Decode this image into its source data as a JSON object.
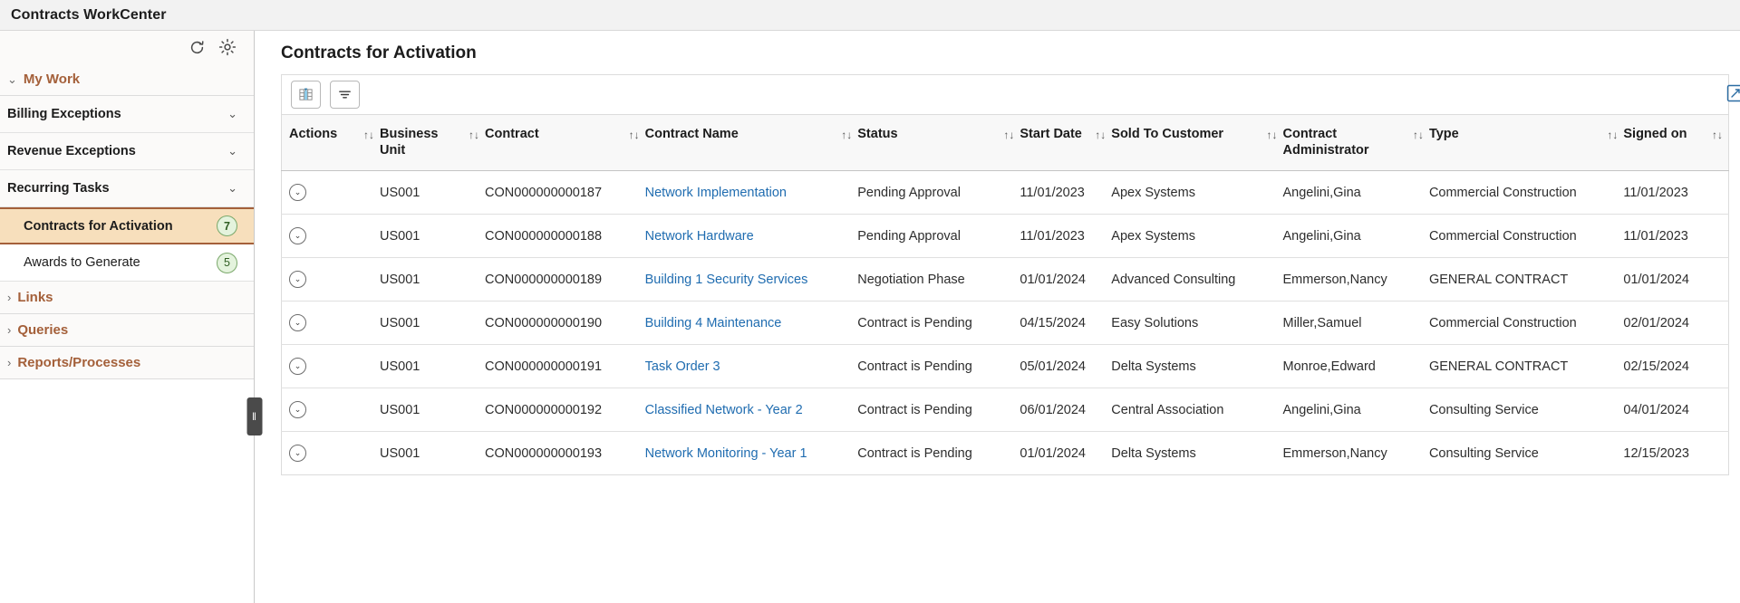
{
  "header": {
    "title": "Contracts WorkCenter"
  },
  "sidebar": {
    "tools": [
      {
        "name": "refresh-icon",
        "label": "Refresh"
      },
      {
        "name": "gear-icon",
        "label": "Settings"
      }
    ],
    "groups": [
      {
        "label": "My Work",
        "expanded": true,
        "caret": "⌄"
      },
      {
        "label": "Links",
        "expanded": false,
        "caret": "›"
      },
      {
        "label": "Queries",
        "expanded": false,
        "caret": "›"
      },
      {
        "label": "Reports/Processes",
        "expanded": false,
        "caret": "›"
      }
    ],
    "my_work_items": [
      {
        "label": "Billing Exceptions",
        "chevron": "⌄"
      },
      {
        "label": "Revenue Exceptions",
        "chevron": "⌄"
      },
      {
        "label": "Recurring Tasks",
        "chevron": "⌄"
      }
    ],
    "children": [
      {
        "label": "Contracts for Activation",
        "count": "7",
        "selected": true
      },
      {
        "label": "Awards to Generate",
        "count": "5",
        "selected": false
      }
    ],
    "collapse_handle": "‖"
  },
  "main": {
    "title": "Contracts for Activation",
    "toolbar": {
      "chart_button_label": "Chart view",
      "filter_button_label": "Filter",
      "personalize_label": "Personalize"
    },
    "table": {
      "sort_glyph": "↑↓",
      "action_glyph": "⌄",
      "columns": [
        {
          "label": "Actions",
          "sortable": true,
          "cls": "c-actions"
        },
        {
          "label": "Business Unit",
          "sortable": true,
          "cls": "c-bu"
        },
        {
          "label": "Contract",
          "sortable": true,
          "cls": "c-contract"
        },
        {
          "label": "Contract Name",
          "sortable": true,
          "cls": "c-name"
        },
        {
          "label": "Status",
          "sortable": true,
          "cls": "c-status"
        },
        {
          "label": "Start Date",
          "sortable": true,
          "cls": "c-start"
        },
        {
          "label": "Sold To Customer",
          "sortable": true,
          "cls": "c-sold"
        },
        {
          "label": "Contract Administrator",
          "sortable": true,
          "cls": "c-admin"
        },
        {
          "label": "Type",
          "sortable": true,
          "cls": "c-type"
        },
        {
          "label": "Signed on",
          "sortable": true,
          "cls": "c-signed"
        }
      ],
      "rows": [
        {
          "business_unit": "US001",
          "contract": "CON000000000187",
          "contract_name": "Network Implementation",
          "status": "Pending Approval",
          "start_date": "11/01/2023",
          "sold_to_customer": "Apex Systems",
          "contract_administrator": "Angelini,Gina",
          "type": "Commercial Construction",
          "signed_on": "11/01/2023"
        },
        {
          "business_unit": "US001",
          "contract": "CON000000000188",
          "contract_name": "Network Hardware",
          "status": "Pending Approval",
          "start_date": "11/01/2023",
          "sold_to_customer": "Apex Systems",
          "contract_administrator": "Angelini,Gina",
          "type": "Commercial Construction",
          "signed_on": "11/01/2023"
        },
        {
          "business_unit": "US001",
          "contract": "CON000000000189",
          "contract_name": "Building 1 Security Services",
          "status": "Negotiation Phase",
          "start_date": "01/01/2024",
          "sold_to_customer": "Advanced Consulting",
          "contract_administrator": "Emmerson,Nancy",
          "type": "GENERAL CONTRACT",
          "signed_on": "01/01/2024"
        },
        {
          "business_unit": "US001",
          "contract": "CON000000000190",
          "contract_name": "Building 4 Maintenance",
          "status": "Contract is Pending",
          "start_date": "04/15/2024",
          "sold_to_customer": "Easy Solutions",
          "contract_administrator": "Miller,Samuel",
          "type": "Commercial Construction",
          "signed_on": "02/01/2024"
        },
        {
          "business_unit": "US001",
          "contract": "CON000000000191",
          "contract_name": "Task Order 3",
          "status": "Contract is Pending",
          "start_date": "05/01/2024",
          "sold_to_customer": "Delta Systems",
          "contract_administrator": "Monroe,Edward",
          "type": "GENERAL CONTRACT",
          "signed_on": "02/15/2024"
        },
        {
          "business_unit": "US001",
          "contract": "CON000000000192",
          "contract_name": "Classified Network - Year 2",
          "status": "Contract is Pending",
          "start_date": "06/01/2024",
          "sold_to_customer": "Central Association",
          "contract_administrator": "Angelini,Gina",
          "type": "Consulting Service",
          "signed_on": "04/01/2024"
        },
        {
          "business_unit": "US001",
          "contract": "CON000000000193",
          "contract_name": "Network Monitoring - Year 1",
          "status": "Contract is Pending",
          "start_date": "01/01/2024",
          "sold_to_customer": "Delta Systems",
          "contract_administrator": "Emmerson,Nancy",
          "type": "Consulting Service",
          "signed_on": "12/15/2023"
        }
      ]
    }
  },
  "colors": {
    "accent_orange": "#a4603a",
    "link_blue": "#1f6cb0",
    "selected_bg": "#f7dfbc",
    "badge_green_bg": "#e4f3dd",
    "badge_green_border": "#7aa86a",
    "header_bg": "#f2f2f2"
  }
}
